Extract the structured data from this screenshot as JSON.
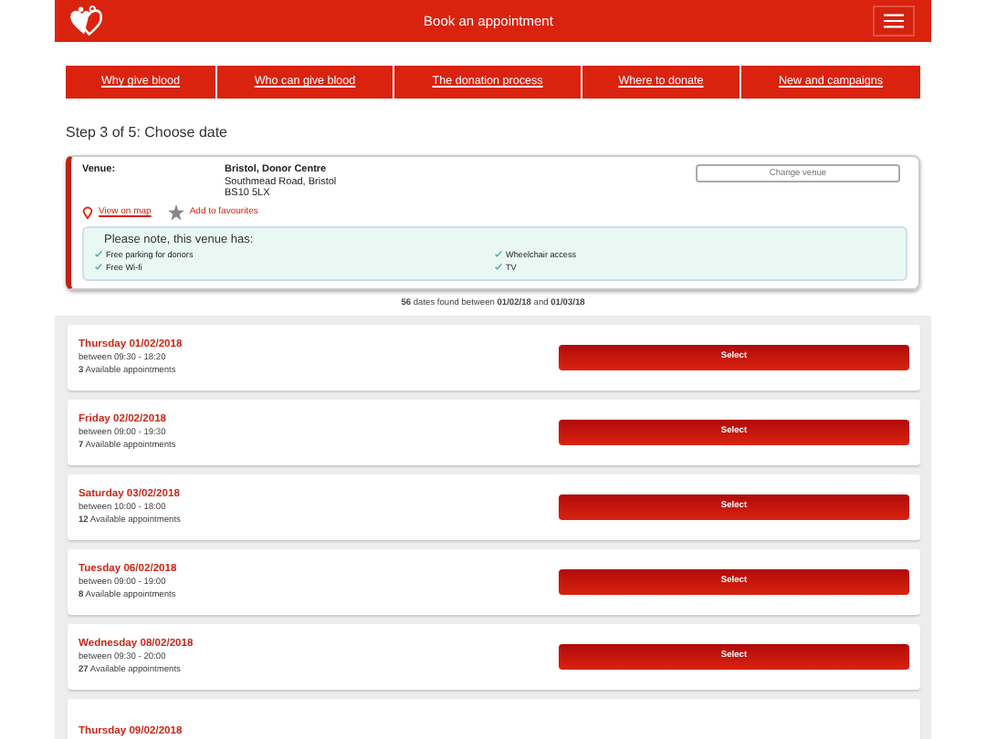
{
  "header": {
    "title": "Book an appointment"
  },
  "nav": [
    {
      "label": "Why give blood"
    },
    {
      "label": "Who can give blood"
    },
    {
      "label": "The donation process"
    },
    {
      "label": "Where to donate"
    },
    {
      "label": "New and campaigns"
    }
  ],
  "step_title": "Step 3 of 5: Choose date",
  "venue": {
    "label": "Venue:",
    "name": "Bristol, Donor Centre",
    "address": [
      "Southmead Road, Bristol",
      "BS10 5LX"
    ],
    "change_button": "Change venue",
    "map_link": "View on map",
    "favourite_link": "Add to favourites",
    "note": {
      "title": "Please note, this venue has:",
      "facilities": [
        "Free parking for donors",
        "Wheelchair access",
        "Free Wi-fi",
        "TV"
      ]
    }
  },
  "summary": "**56** dates found between **01/02/18** and **01/03/18**",
  "dates": [
    {
      "date": "Thursday 01/02/2018",
      "hours": "between 09:30 - 18:20",
      "availability": "**3** Available appointments",
      "button": "Select"
    },
    {
      "date": "Friday 02/02/2018",
      "hours": "between 09:00 - 19:30",
      "availability": "**7** Available appointments",
      "button": "Select"
    },
    {
      "date": "Saturday 03/02/2018",
      "hours": "between 10:00 - 18:00",
      "availability": "**12** Available appointments",
      "button": "Select"
    },
    {
      "date": "Tuesday 06/02/2018",
      "hours": "between 09:00 - 19:00",
      "availability": "**8** Available appointments",
      "button": "Select"
    },
    {
      "date": "Wednesday 08/02/2018",
      "hours": "between 09:30 - 20:00",
      "availability": "**27** Available appointments",
      "button": "Select"
    },
    {
      "date": "Thursday 09/02/2018"
    }
  ]
}
